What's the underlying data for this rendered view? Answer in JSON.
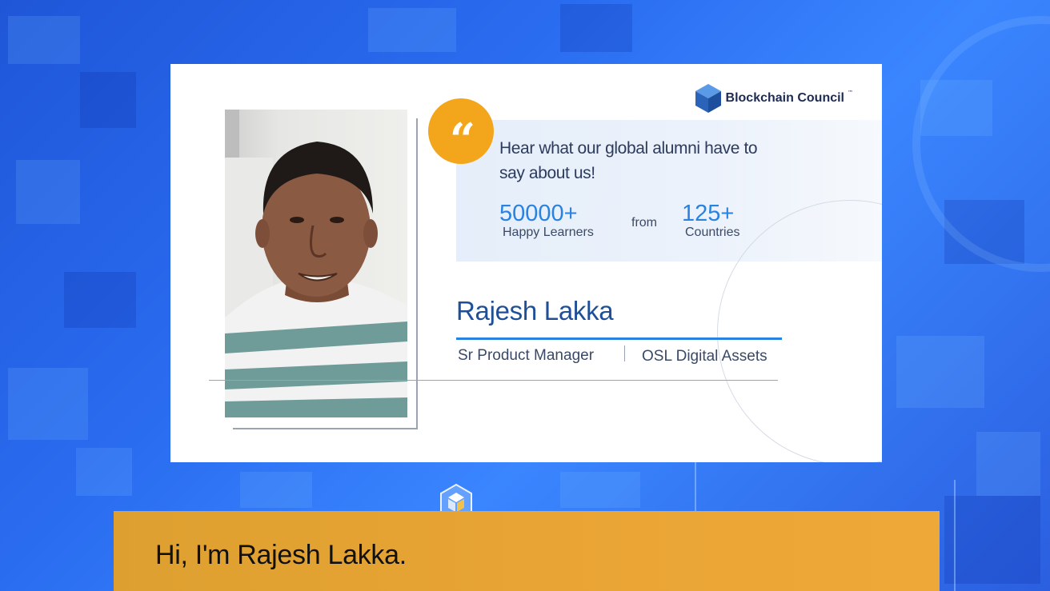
{
  "brand": {
    "name": "Blockchain Council",
    "tm": "™"
  },
  "quote": {
    "mark": "“",
    "headline": "Hear what our global alumni have to say about us!"
  },
  "stats": {
    "learners": {
      "value": "50000+",
      "label": "Happy Learners"
    },
    "connector": "from",
    "countries": {
      "value": "125+",
      "label": "Countries"
    }
  },
  "person": {
    "name": "Rajesh Lakka",
    "role": "Sr Product Manager",
    "company": "OSL Digital Assets"
  },
  "caption": {
    "text": "Hi, I'm Rajesh Lakka."
  },
  "colors": {
    "accent_orange": "#f3a61c",
    "accent_blue": "#2a82e0",
    "name_blue": "#1f4f97",
    "caption_bar": "#e8a434",
    "background_blue": "#2a6cf0"
  },
  "icons": {
    "brand_logo": "cube-logo-icon",
    "quote_badge": "quote-icon",
    "bottom_emblem": "blockchain-emblem-icon"
  }
}
